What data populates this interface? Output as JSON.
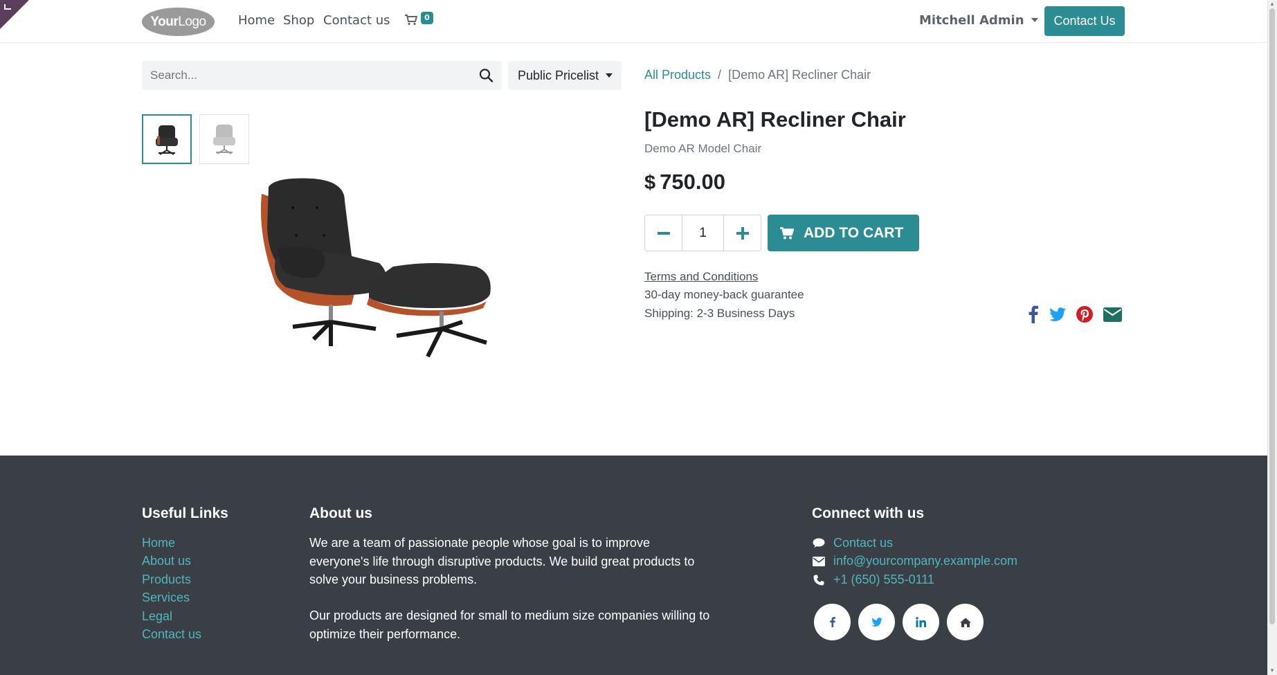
{
  "header": {
    "logo_text_bold": "Your",
    "logo_text_rest": "Logo",
    "nav": [
      {
        "label": "Home"
      },
      {
        "label": "Shop"
      },
      {
        "label": "Contact us"
      }
    ],
    "cart_count": "0",
    "user_name": "Mitchell Admin",
    "contact_button": "Contact Us"
  },
  "toolbar": {
    "search_placeholder": "Search...",
    "pricelist": "Public Pricelist"
  },
  "breadcrumb": {
    "parent": "All Products",
    "separator": "/",
    "current": "[Demo AR] Recliner Chair"
  },
  "product": {
    "title": "[Demo AR] Recliner Chair",
    "subtitle": "Demo AR Model Chair",
    "currency": "$",
    "price": "750.00",
    "quantity": "1",
    "add_to_cart": "ADD TO CART",
    "terms": "Terms and Conditions",
    "guarantee": "30-day money-back guarantee",
    "shipping": "Shipping: 2-3 Business Days"
  },
  "footer": {
    "useful_links_title": "Useful Links",
    "useful_links": [
      "Home",
      "About us",
      "Products",
      "Services",
      "Legal",
      "Contact us"
    ],
    "about_title": "About us",
    "about_p1": "We are a team of passionate people whose goal is to improve everyone's life through disruptive products. We build great products to solve your business problems.",
    "about_p2": "Our products are designed for small to medium size companies willing to optimize their performance.",
    "connect_title": "Connect with us",
    "contact_link": "Contact us",
    "email": "info@yourcompany.example.com",
    "phone": "+1 (650) 555-0111"
  },
  "colors": {
    "primary": "#2b8c94",
    "footer_bg": "#3a3f46",
    "footer_link": "#4fb6bd",
    "corner": "#5a3e5c"
  }
}
